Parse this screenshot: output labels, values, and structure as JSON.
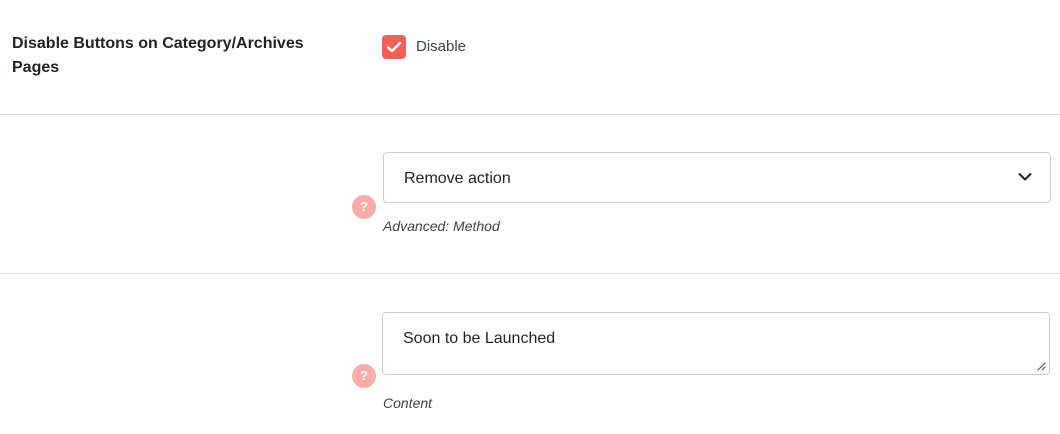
{
  "disable_buttons_setting": {
    "label": "Disable Buttons on Category/Archives Pages",
    "checkbox_label": "Disable",
    "checked": true
  },
  "method_setting": {
    "selected_value": "Remove action",
    "description": "Advanced: Method",
    "help_icon": "?"
  },
  "content_setting": {
    "value": "Soon to be Launched",
    "description": "Content",
    "help_icon": "?"
  },
  "colors": {
    "accent": "#ee6159",
    "help_icon": "#f6aca6",
    "border": "#c9ccd1",
    "divider": "#dcdcde"
  },
  "icons": {
    "checkbox": "check-icon",
    "select": "chevron-down-icon",
    "help": "help-icon",
    "resize": "resize-handle-icon"
  }
}
